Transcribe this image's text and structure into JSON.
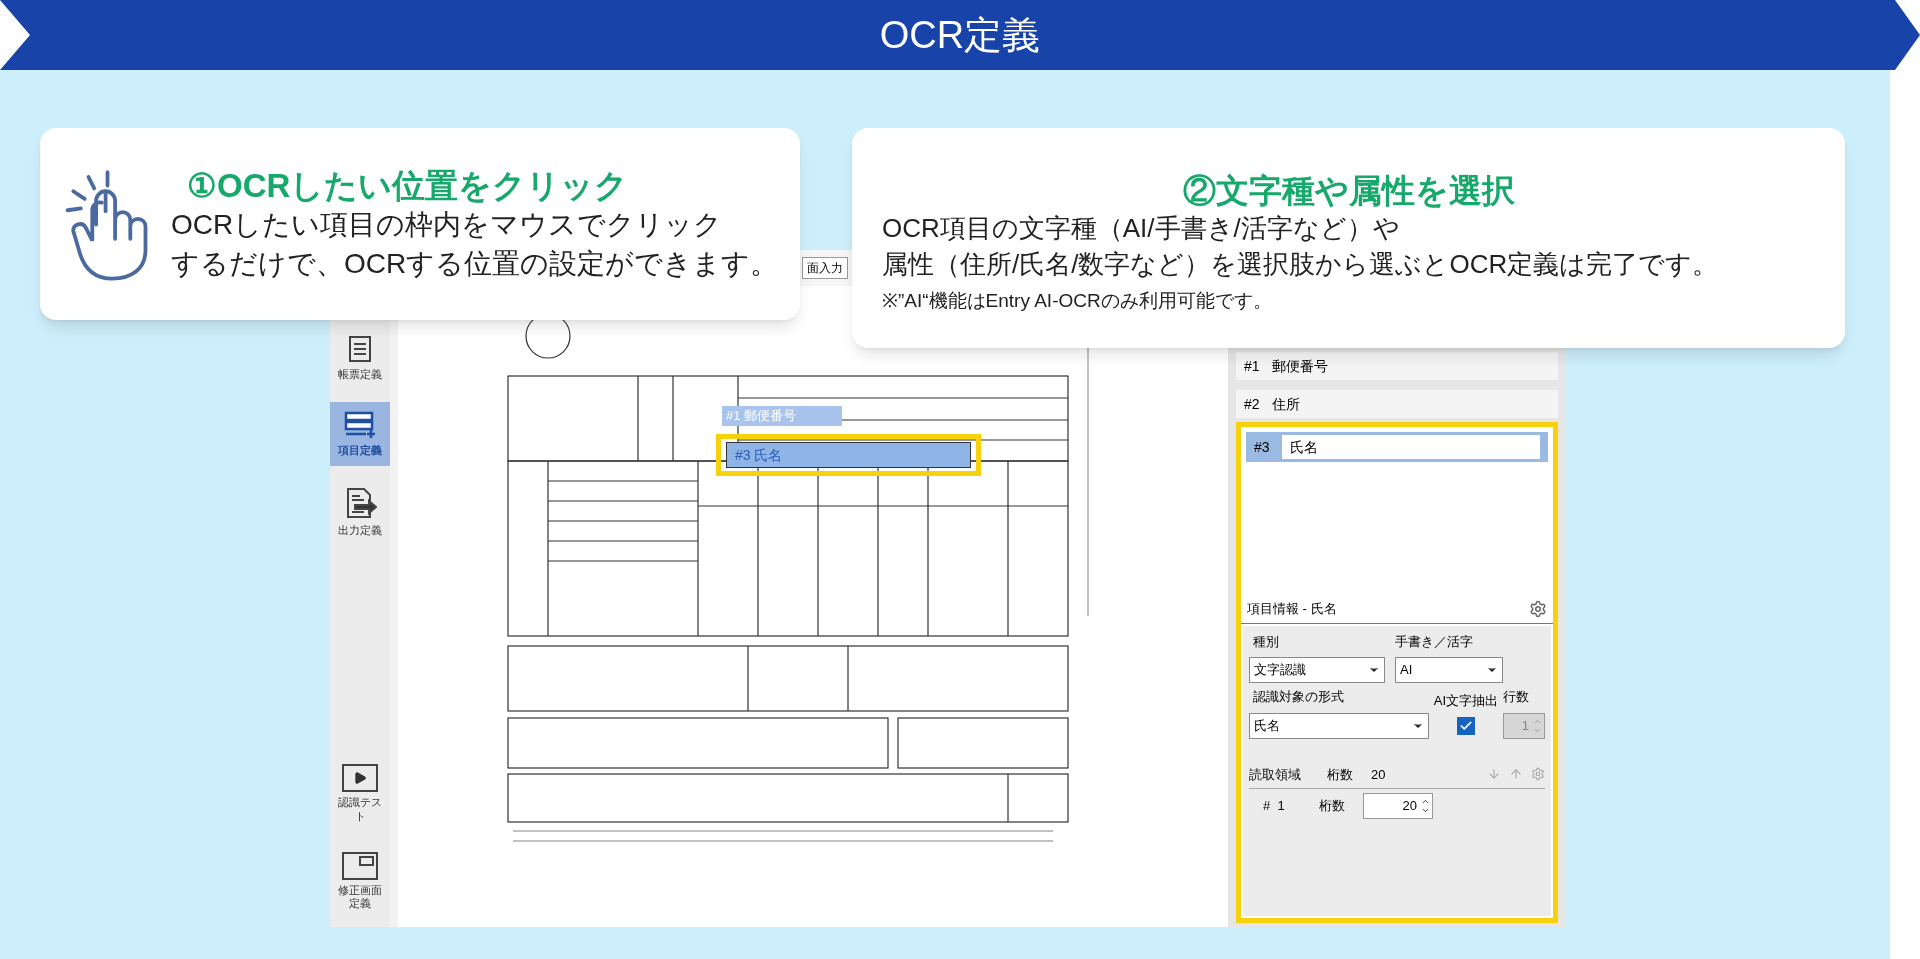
{
  "banner": {
    "title": "OCR定義"
  },
  "callouts": [
    {
      "kind": "click",
      "title": "①OCRしたい位置をクリック",
      "lines": [
        "OCRしたい項目の枠内をマウスでクリック",
        "するだけで、OCRする位置の設定ができます。"
      ]
    },
    {
      "kind": "select",
      "title": "②文字種や属性を選択",
      "lines": [
        "OCR項目の文字種（AI/手書き/活字など）や",
        "属性（住所/氏名/数字など）を選択肢から選ぶとOCR定義は完了です。"
      ],
      "note": "※”AI“機能はEntry AI-OCRのみ利用可能です。"
    }
  ],
  "sidebar": {
    "items": [
      {
        "kind": "form",
        "label": "帳票定義",
        "selected": false
      },
      {
        "kind": "item",
        "label": "項目定義",
        "selected": true
      },
      {
        "kind": "output",
        "label": "出力定義",
        "selected": false
      },
      {
        "kind": "test",
        "label": "認識テスト",
        "selected": false
      },
      {
        "kind": "screen",
        "label": "修正画面定義",
        "selected": false
      }
    ]
  },
  "toolbar": {
    "button": "面入力"
  },
  "form_overlays": [
    {
      "label": "#1 郵便番号",
      "selected": false
    },
    {
      "label": "#3 氏名",
      "selected": true
    }
  ],
  "items": [
    {
      "number": "#1",
      "name": "郵便番号",
      "selected": false
    },
    {
      "number": "#2",
      "name": "住所",
      "selected": false
    },
    {
      "number": "#3",
      "name": "氏名",
      "selected": true
    }
  ],
  "item_info": {
    "title": "項目情報 - 氏名",
    "type_label": "種別",
    "type_value": "文字認識",
    "hand_label": "手書き／活字",
    "hand_value": "AI",
    "format_label": "認識対象の形式",
    "format_value": "氏名",
    "ai_extract_label": "AI文字抽出",
    "ai_extract_checked": true,
    "lines_label": "行数",
    "lines_value": "1",
    "lines_disabled": true
  },
  "read_area": {
    "label": "読取領域",
    "digits_label": "桁数",
    "digits_value": "20",
    "rows": [
      {
        "number": "#  1",
        "digits_label": "桁数",
        "digits_value": "20"
      }
    ]
  }
}
